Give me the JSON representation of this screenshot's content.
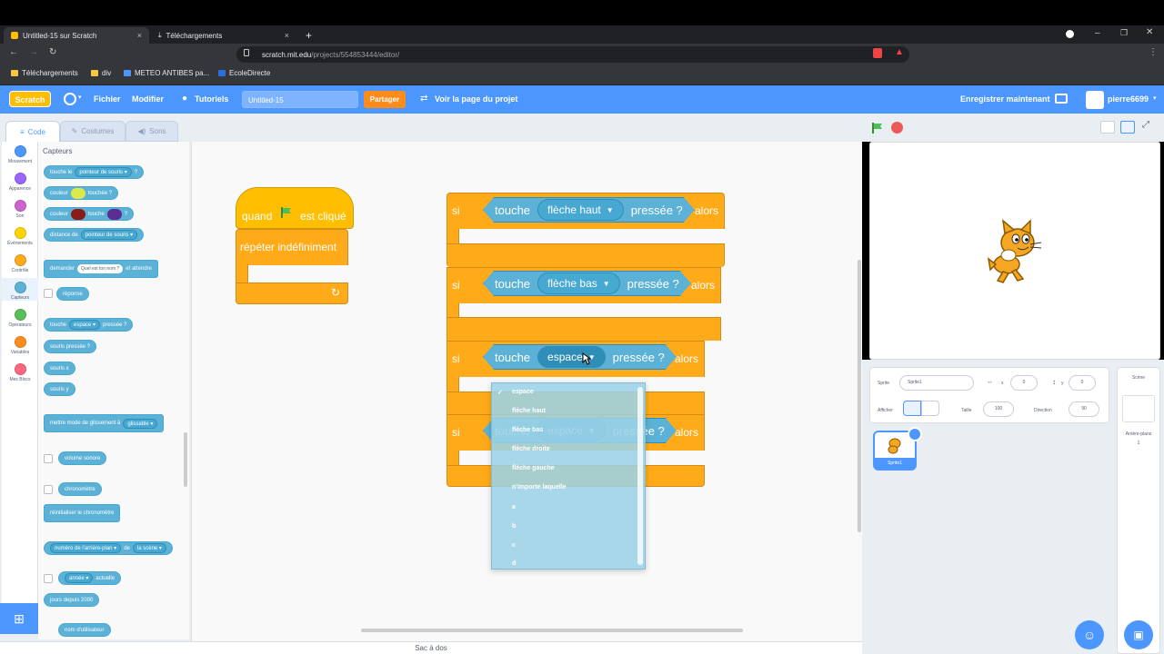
{
  "browser": {
    "tabs": [
      {
        "label": "Untitled-15 sur Scratch",
        "close": "×"
      },
      {
        "label": "Téléchargements",
        "close": "×"
      }
    ],
    "new_tab": "+",
    "url_host": "scratch.mit.edu",
    "url_path": "/projects/554853444/editor/",
    "bookmarks": [
      "Téléchargements",
      "div",
      "METEO ANTIBES pa...",
      "EcoleDirecte"
    ]
  },
  "scratch_menu": {
    "logo": "Scratch",
    "items": [
      "Fichier",
      "Modifier",
      "Tutoriels"
    ],
    "project_title": "Untitled-15",
    "share": "Partager",
    "see_project": "Voir la page du projet",
    "save_now": "Enregistrer maintenant",
    "user": "pierre6699"
  },
  "editor_tabs": [
    "Code",
    "Costumes",
    "Sons"
  ],
  "categories": [
    {
      "label": "Mouvement",
      "color": "#4c97ff"
    },
    {
      "label": "Apparence",
      "color": "#9966ff"
    },
    {
      "label": "Son",
      "color": "#cf63cf"
    },
    {
      "label": "Événements",
      "color": "#ffd500"
    },
    {
      "label": "Contrôle",
      "color": "#ffab19"
    },
    {
      "label": "Capteurs",
      "color": "#5cb1d6"
    },
    {
      "label": "Opérateurs",
      "color": "#59c059"
    },
    {
      "label": "Variables",
      "color": "#ff8c1a"
    },
    {
      "label": "Mes Blocs",
      "color": "#ff6680"
    }
  ],
  "palette": {
    "heading": "Capteurs",
    "blocks": [
      {
        "a": "touche le",
        "b": "pointeur de souris ▾",
        "c": "?"
      },
      {
        "a": "couleur",
        "b": "",
        "c": "touchée ?"
      },
      {
        "a": "couleur",
        "b": "",
        "c": "touche"
      },
      {
        "a": "distance de",
        "b": "pointeur de souris ▾",
        "c": ""
      },
      {
        "a": "demander",
        "b": "Quel est ton nom ?",
        "c": "et attendre"
      },
      {
        "a": "réponse",
        "b": "",
        "c": ""
      },
      {
        "a": "touche",
        "b": "espace ▾",
        "c": "pressée ?"
      },
      {
        "a": "souris pressée ?",
        "b": "",
        "c": ""
      },
      {
        "a": "souris x",
        "b": "",
        "c": ""
      },
      {
        "a": "souris y",
        "b": "",
        "c": ""
      },
      {
        "a": "mettre mode de glissement à",
        "b": "glissable ▾",
        "c": ""
      },
      {
        "a": "volume sonore",
        "b": "",
        "c": ""
      },
      {
        "a": "chronomètre",
        "b": "",
        "c": ""
      },
      {
        "a": "réinitialiser le chronomètre",
        "b": "",
        "c": ""
      },
      {
        "a": "numéro de l'arrière-plan ▾",
        "b": "de",
        "c": "la scène ▾"
      },
      {
        "a": "année ▾",
        "b": "actuelle",
        "c": ""
      },
      {
        "a": "jours depuis 2000",
        "b": "",
        "c": ""
      },
      {
        "a": "nom d'utilisateur",
        "b": "",
        "c": ""
      }
    ]
  },
  "script1": {
    "hat_pre": "quand",
    "hat_post": "est cliqué",
    "forever": "répéter indéfiniment",
    "loop_arrow": "↻"
  },
  "script2": {
    "if_label": "si",
    "then_label": "alors",
    "touch_label": "touche",
    "pressed_label": "pressée ?",
    "keys": [
      "flèche haut",
      "flèche bas",
      "espace",
      "espace"
    ]
  },
  "dropdown": {
    "check": "✓",
    "options": [
      "espace",
      "flèche haut",
      "flèche bas",
      "flèche droite",
      "flèche gauche",
      "n'importe laquelle",
      "a",
      "b",
      "c",
      "d"
    ],
    "selected_index": 0
  },
  "zoom": [
    "+",
    "−",
    "="
  ],
  "stage": {
    "sprite_label": "Sprite",
    "sprite_name": "Sprite1",
    "x_label": "x",
    "x_value": "0",
    "y_label": "y",
    "y_value": "0",
    "show_label": "Afficher",
    "size_label": "Taille",
    "size_value": "100",
    "direction_label": "Direction",
    "direction_value": "90",
    "stage_col_label": "Scène",
    "backdrops_label": "Arrière-plans",
    "backdrops_count": "1",
    "thumb_name": "Sprite1"
  },
  "backpack": "Sac à dos",
  "colors": {
    "scratch_blue": "#4c97ff",
    "control": "#ffab19",
    "sensing": "#5cb1d6",
    "events": "#ffd500"
  }
}
